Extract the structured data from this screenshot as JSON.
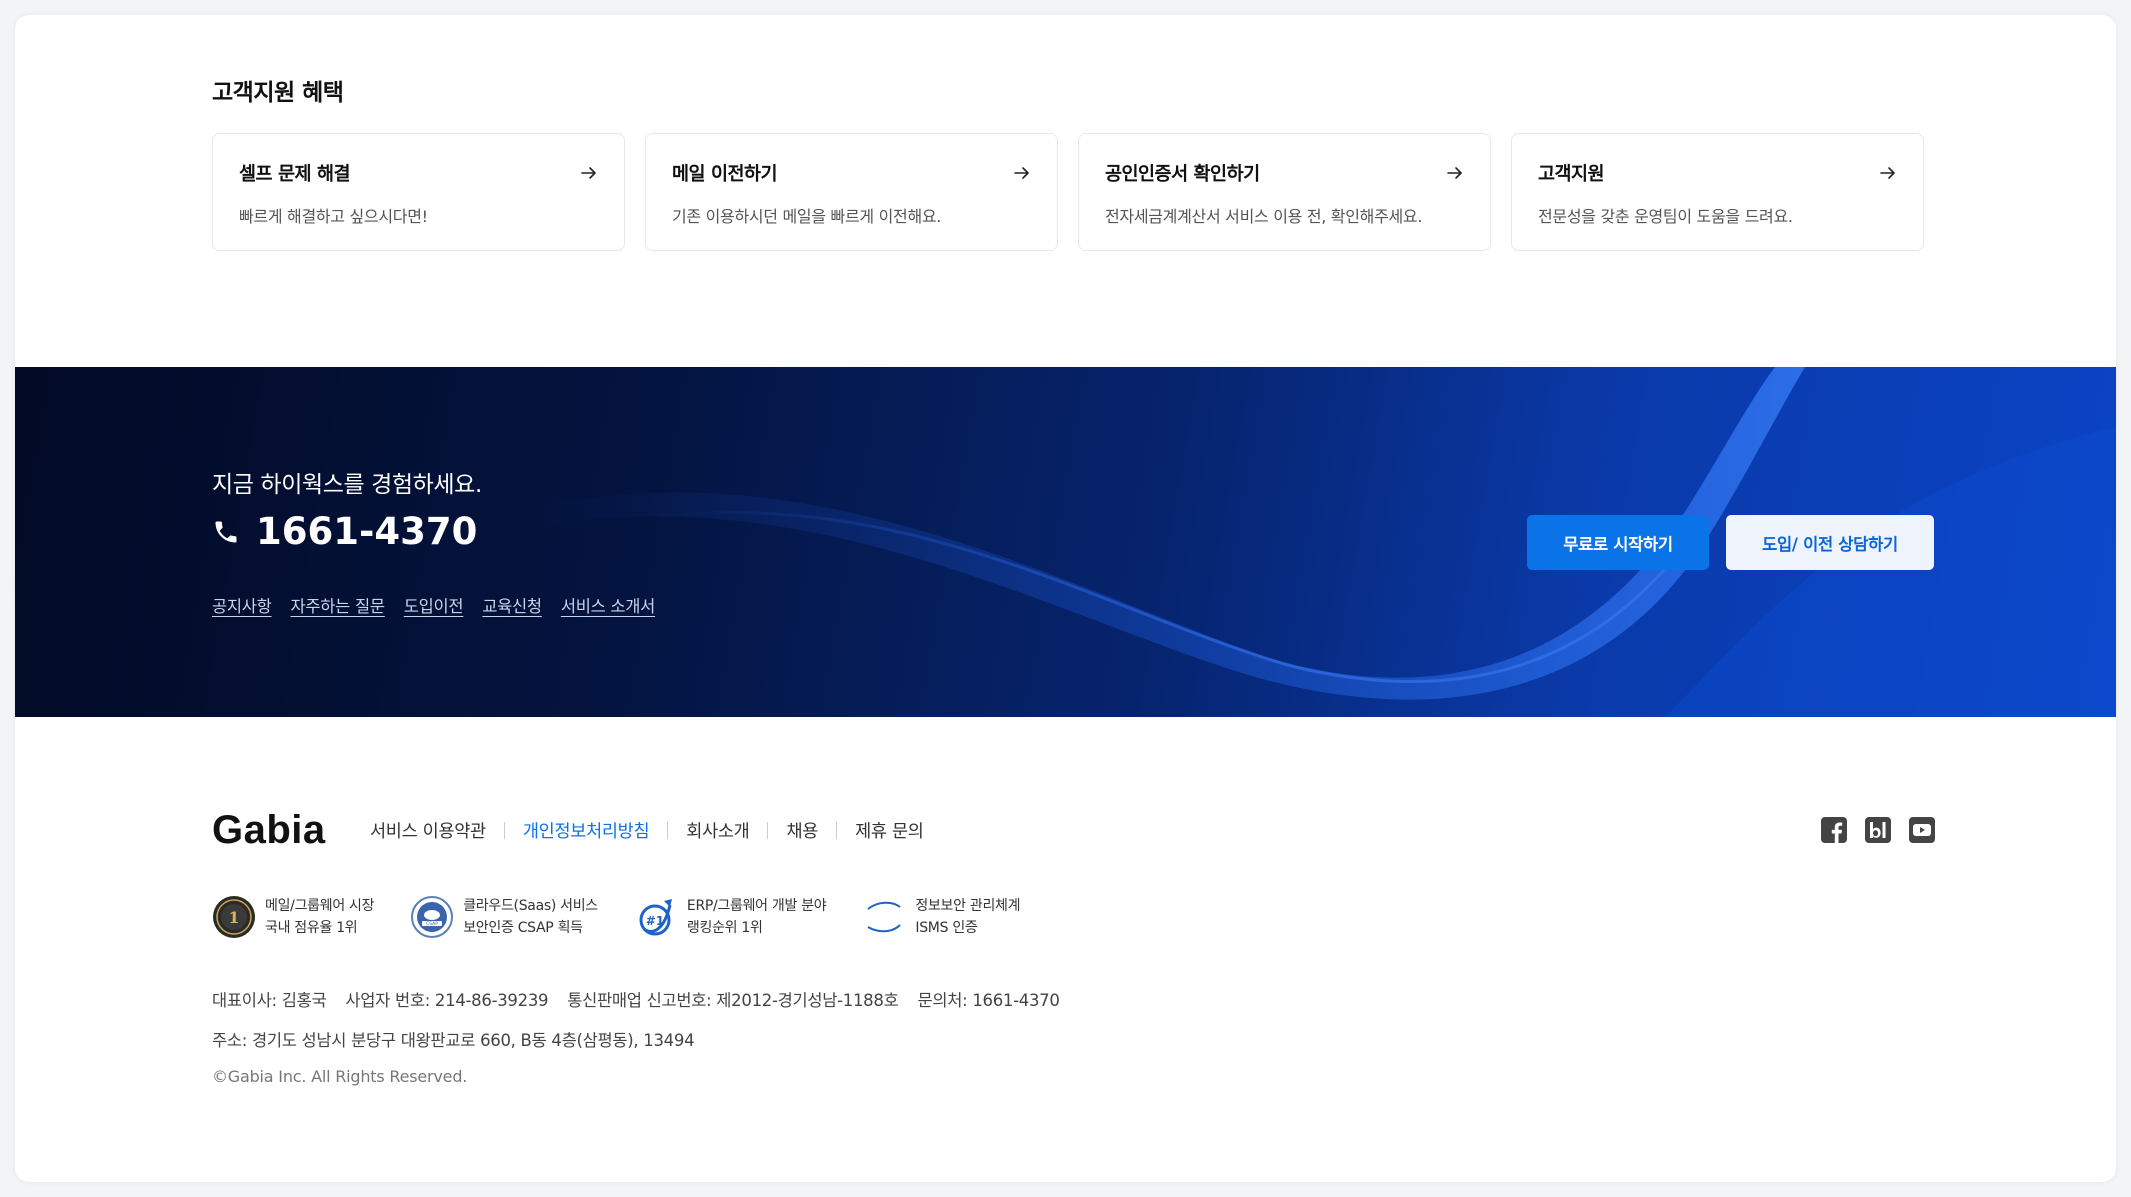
{
  "benefits": {
    "title": "고객지원 혜택",
    "cards": [
      {
        "title": "셀프 문제 해결",
        "desc": "빠르게 해결하고 싶으시다면!"
      },
      {
        "title": "메일 이전하기",
        "desc": "기존 이용하시던 메일을 빠르게 이전해요."
      },
      {
        "title": "공인인증서 확인하기",
        "desc": "전자세금계계산서 서비스 이용 전, 확인해주세요."
      },
      {
        "title": "고객지원",
        "desc": "전문성을 갖춘 운영팀이 도움을 드려요."
      }
    ]
  },
  "banner": {
    "tagline": "지금 하이웍스를 경험하세요.",
    "phone": "1661-4370",
    "links": [
      "공지사항",
      "자주하는 질문",
      "도입이전",
      "교육신청",
      "서비스 소개서"
    ],
    "start_label": "무료로 시작하기",
    "consult_label": "도입/ 이전 상담하기"
  },
  "footer": {
    "logo": "Gabia",
    "nav": [
      {
        "label": "서비스 이용약관",
        "active": false
      },
      {
        "label": "개인정보처리방침",
        "active": true
      },
      {
        "label": "회사소개",
        "active": false
      },
      {
        "label": "채용",
        "active": false
      },
      {
        "label": "제휴 문의",
        "active": false
      }
    ],
    "social_icons": [
      "facebook-icon",
      "blog-icon",
      "youtube-icon"
    ],
    "certs": [
      {
        "line1": "메일/그룹웨어 시장",
        "line2": "국내 점유율 1위",
        "icon": "market-share-medal-icon"
      },
      {
        "line1": "클라우드(Saas) 서비스",
        "line2": "보안인증 CSAP 획득",
        "icon": "csap-badge-icon"
      },
      {
        "line1": "ERP/그룹웨어 개발 분야",
        "line2": "랭킹순위 1위",
        "icon": "ranking-first-icon"
      },
      {
        "line1": "정보보안 관리체계",
        "line2": "ISMS 인증",
        "icon": "isms-logo-icon"
      }
    ],
    "info": {
      "ceo": "대표이사: 김홍국",
      "biz_no": "사업자 번호: 214-86-39239",
      "telecom_no": "통신판매업 신고번호: 제2012-경기성남-1188호",
      "contact": "문의처: 1661-4370",
      "address": "주소: 경기도 성남시 분당구 대왕판교로 660, B동 4층(삼평동), 13494",
      "copyright": "©Gabia Inc. All Rights Reserved."
    }
  },
  "colors": {
    "accent": "#0a73e8",
    "banner_dark": "#020a25",
    "banner_light": "#0b44c6"
  }
}
